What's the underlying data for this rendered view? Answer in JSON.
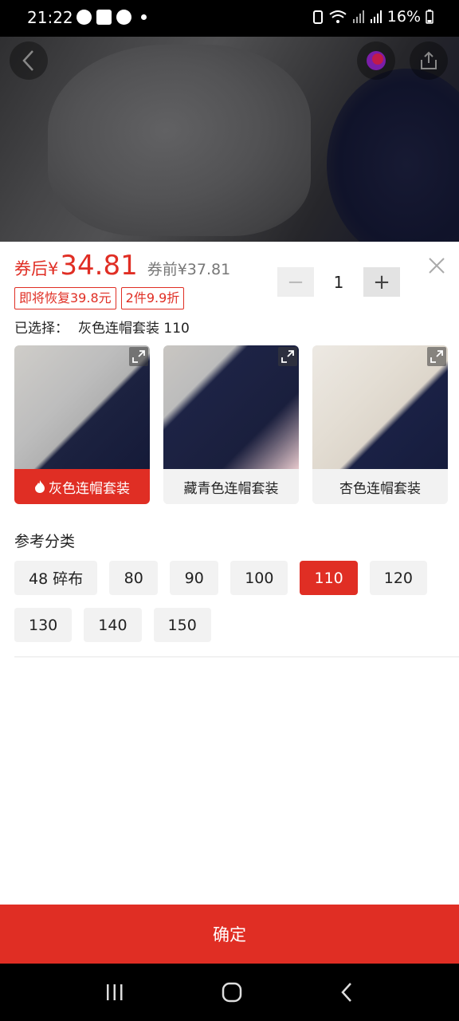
{
  "status_bar": {
    "time": "21:22",
    "battery": "16%",
    "left_icons": [
      "navigation-icon",
      "gallery-icon",
      "navigation-icon",
      "dot-icon"
    ],
    "right_icons": [
      "battery-saver-icon",
      "wifi-icon",
      "signal-icon",
      "signal-icon",
      "battery-icon"
    ]
  },
  "header": {
    "back_icon": "chevron-left-icon",
    "share_icon": "share-icon"
  },
  "price": {
    "prefix": "券后¥",
    "value": "34.81",
    "original": "券前¥37.81",
    "color": "#e02e24"
  },
  "tags": [
    "即将恢复39.8元",
    "2件9.9折"
  ],
  "selected": {
    "label": "已选择：",
    "value": "灰色连帽套装 110"
  },
  "quantity": {
    "minus": "−",
    "value": "1",
    "plus": "+"
  },
  "variants": [
    {
      "label": "灰色连帽套装",
      "active": true
    },
    {
      "label": "藏青色连帽套装",
      "active": false
    },
    {
      "label": "杏色连帽套装",
      "active": false
    }
  ],
  "size_section": {
    "title": "参考分类",
    "options": [
      "48 碎布",
      "80",
      "90",
      "100",
      "110",
      "120",
      "130",
      "140",
      "150"
    ],
    "selected": "110"
  },
  "confirm_label": "确定",
  "nav": [
    "recent-apps-icon",
    "home-icon",
    "back-icon"
  ]
}
